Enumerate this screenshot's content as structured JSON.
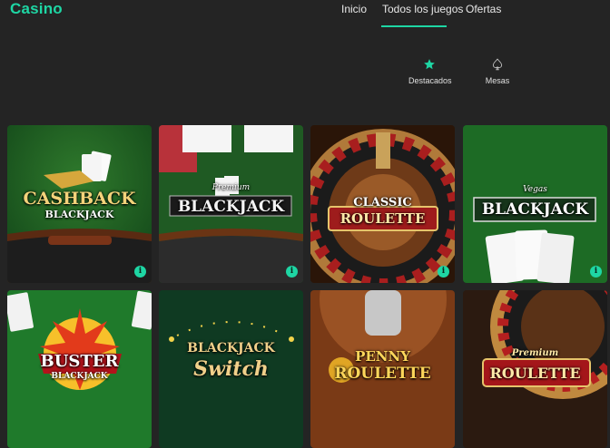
{
  "brand": "Casino",
  "nav": {
    "items": [
      "Inicio",
      "Todos los juegos",
      "Ofertas"
    ],
    "active": 1
  },
  "categories": [
    {
      "label": "Destacados",
      "icon": "star-icon",
      "active": true
    },
    {
      "label": "Mesas",
      "icon": "spade-icon",
      "active": false
    }
  ],
  "games": [
    {
      "title": "CASHBACK",
      "subtitle": "BLACKJACK",
      "info": "i"
    },
    {
      "title": "BLACKJACK",
      "subtitle": "Premium",
      "info": "i"
    },
    {
      "title": "CLASSIC",
      "subtitle": "ROULETTE",
      "info": "i"
    },
    {
      "title": "BLACKJACK",
      "subtitle": "Vegas",
      "info": "i"
    },
    {
      "title": "BUSTER",
      "subtitle": "BLACKJACK"
    },
    {
      "title": "BLACKJACK",
      "subtitle": "Switch"
    },
    {
      "title": "PENNY",
      "subtitle": "ROULETTE"
    },
    {
      "title": "ROULETTE",
      "subtitle": "Premium"
    }
  ],
  "colors": {
    "accent": "#1ed6a4",
    "background": "#242424"
  }
}
